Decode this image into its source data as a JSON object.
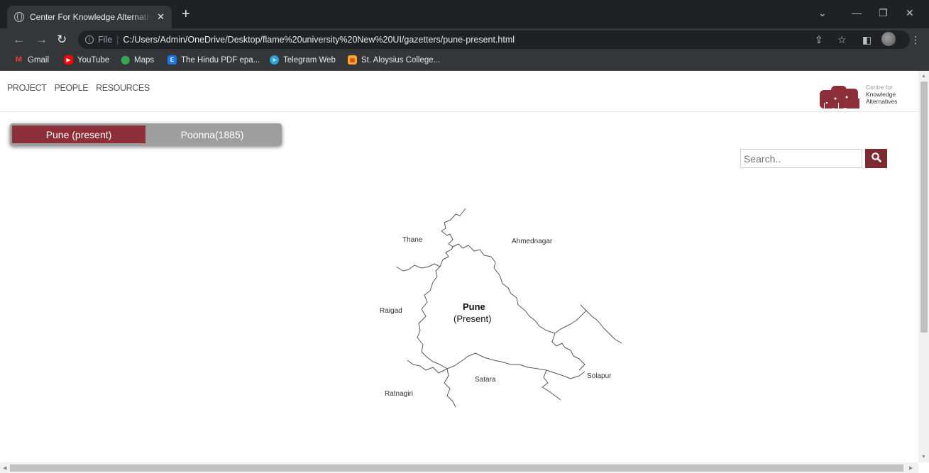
{
  "browser": {
    "tab_title": "Center For Knowledge Alternatives",
    "new_tab": "+",
    "url_prefix": "File",
    "url": "C:/Users/Admin/OneDrive/Desktop/flame%20university%20New%20UI/gazetters/pune-present.html",
    "bookmarks": [
      {
        "label": "Gmail",
        "icon": "gmail-icon",
        "color": "#ea4335"
      },
      {
        "label": "YouTube",
        "icon": "youtube-icon",
        "color": "#ff0000"
      },
      {
        "label": "Maps",
        "icon": "maps-icon",
        "color": "#34a853"
      },
      {
        "label": "The Hindu PDF epa...",
        "icon": "letter-e-icon",
        "color": "#1a73e8"
      },
      {
        "label": "Telegram Web",
        "icon": "telegram-icon",
        "color": "#2aa3e0"
      },
      {
        "label": "St. Aloysius College...",
        "icon": "college-icon",
        "color": "#f9a825"
      }
    ]
  },
  "site": {
    "nav": [
      "PROJECT",
      "PEOPLE",
      "RESOURCES"
    ],
    "logo": {
      "line1": "Centre for",
      "line2": "Knowledge",
      "line3": "Alternatives"
    },
    "accent": "#8c2f39"
  },
  "toggle": {
    "options": [
      {
        "label": "Pune (present)",
        "active": true
      },
      {
        "label": "Poonna(1885)",
        "active": false
      }
    ]
  },
  "search": {
    "placeholder": "Search.."
  },
  "map": {
    "center_title": "Pune",
    "center_subtitle": "(Present)",
    "labels": {
      "thane": "Thane",
      "ahmednagar": "Ahmednagar",
      "raigad": "Raigad",
      "satara": "Satara",
      "solapur": "Solapur",
      "ratnagiri": "Ratnagiri"
    }
  }
}
